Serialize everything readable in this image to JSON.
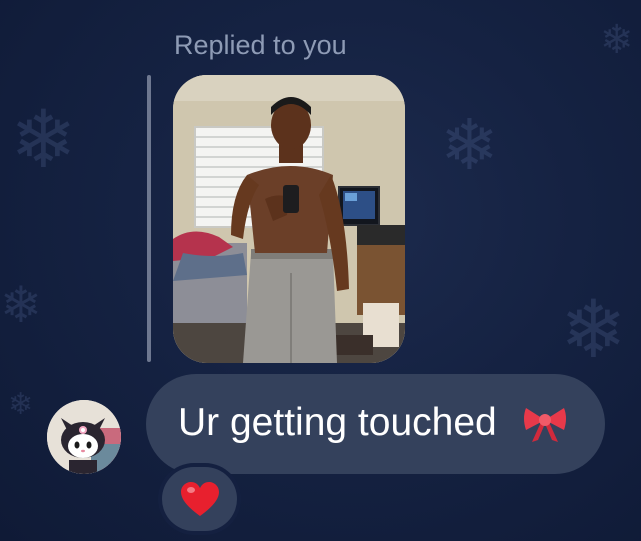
{
  "reply": {
    "label": "Replied to you"
  },
  "photo": {
    "description_icon": "mirror-selfie-photo"
  },
  "message": {
    "text": "Ur getting touched",
    "emoji": "ribbon-emoji"
  },
  "reaction": {
    "emoji": "heart-emoji"
  },
  "sender": {
    "avatar": "kuromi-avatar"
  },
  "colors": {
    "background": "#152242",
    "bubble": "#34415c",
    "reply_label": "#8e9bb5",
    "reply_line": "#6e7890",
    "heart": "#e8202e"
  }
}
